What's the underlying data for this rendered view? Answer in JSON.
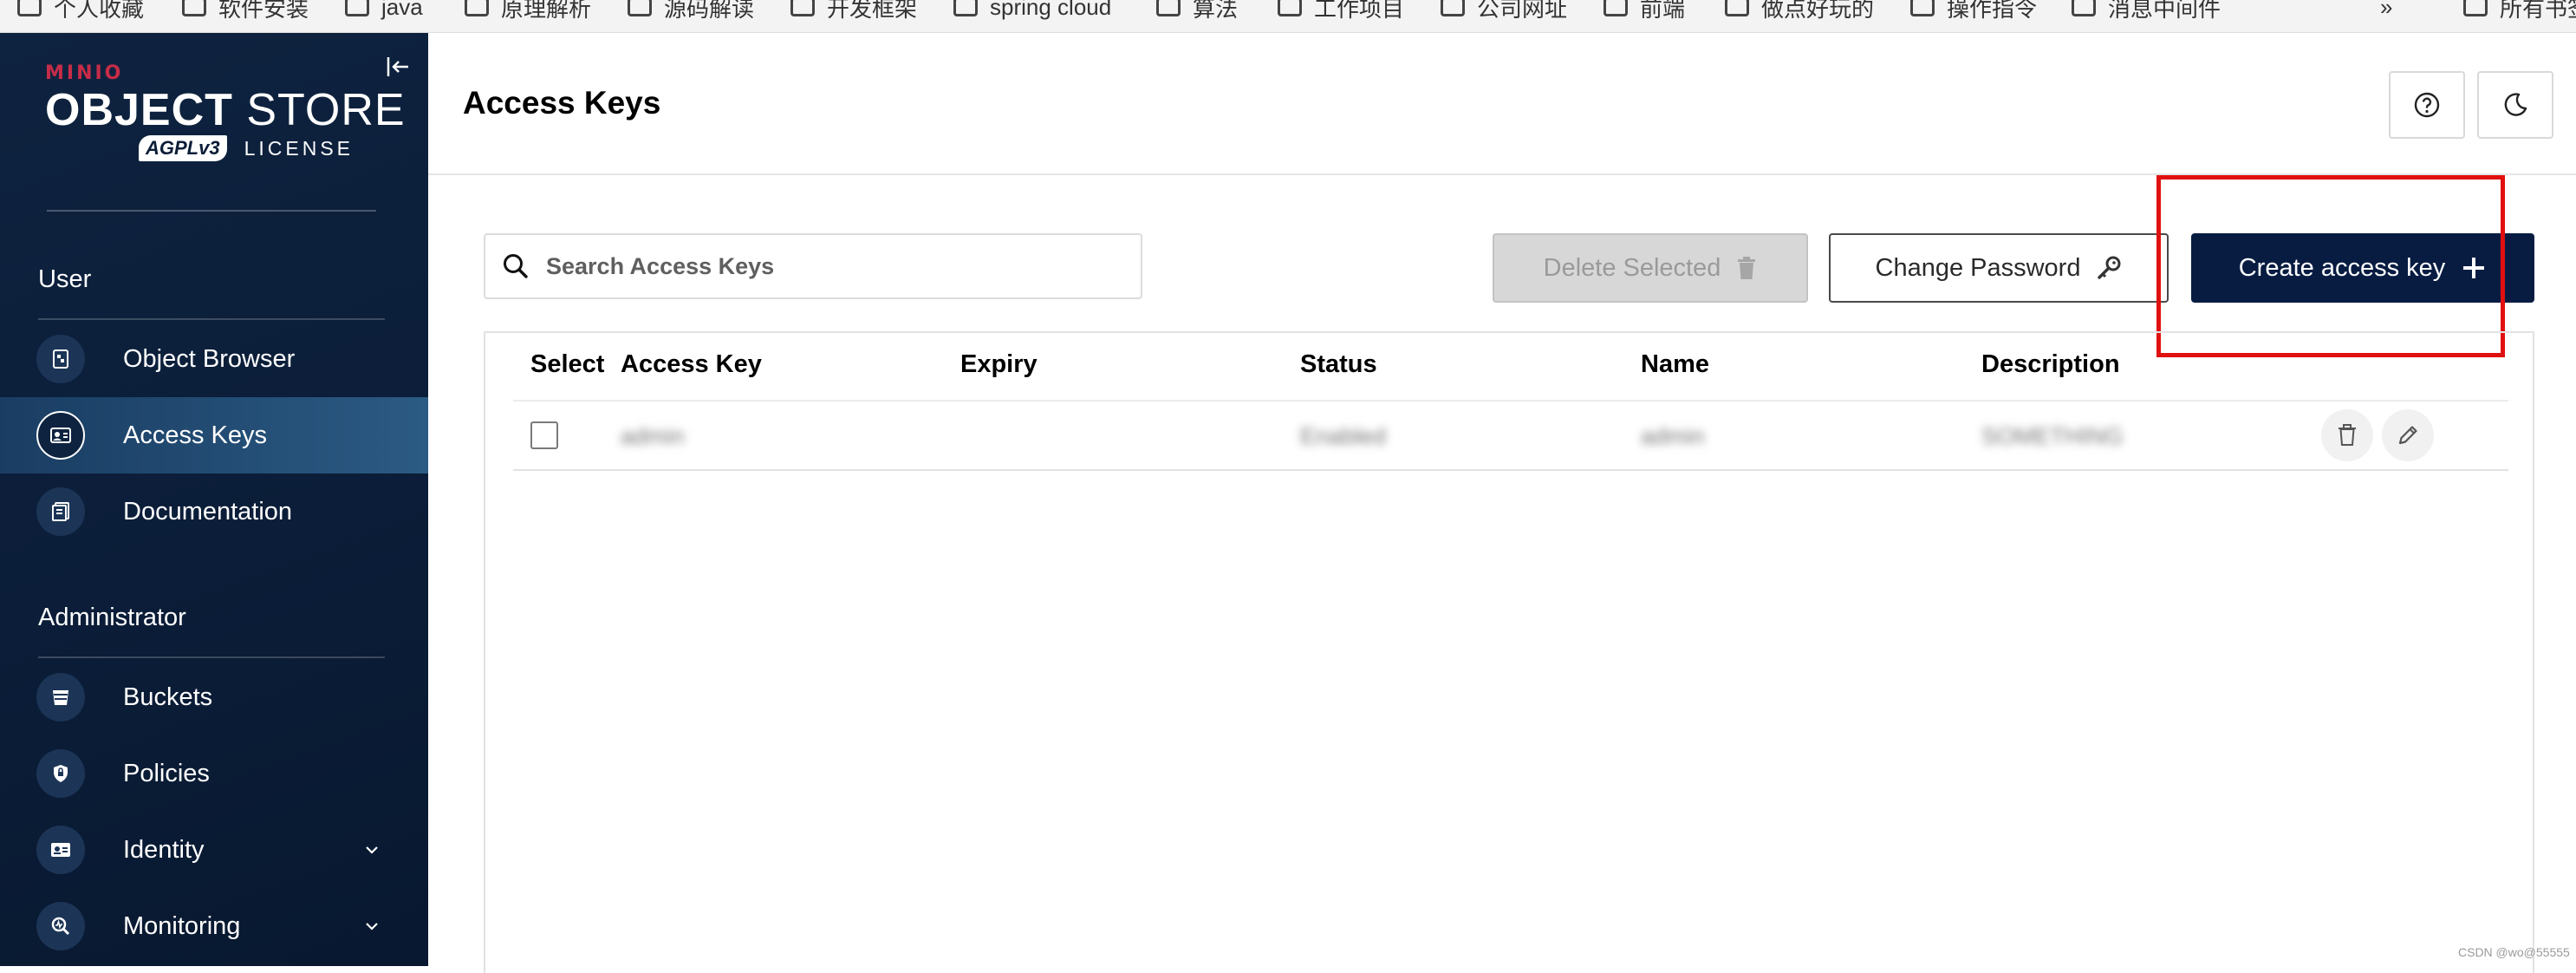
{
  "browser": {
    "bookmarks": [
      "个人收藏",
      "软件安装",
      "java",
      "原理解析",
      "源码解读",
      "开发框架",
      "spring cloud",
      "算法",
      "工作项目",
      "公司网址",
      "前端",
      "做点好玩的",
      "操作指令",
      "消息中间件",
      "所有书签"
    ],
    "overflow_glyph": "»"
  },
  "sidebar": {
    "logo": {
      "brand": "MINIO",
      "product_bold": "OBJECT",
      "product_light": " STORE",
      "license_badge": "AGPLv3",
      "license_text": "LICENSE"
    },
    "user_section": {
      "title": "User",
      "items": [
        {
          "label": "Object Browser",
          "icon": "object-browser-icon"
        },
        {
          "label": "Access Keys",
          "icon": "access-keys-icon",
          "active": true
        },
        {
          "label": "Documentation",
          "icon": "documentation-icon"
        }
      ]
    },
    "admin_section": {
      "title": "Administrator",
      "items": [
        {
          "label": "Buckets",
          "icon": "buckets-icon"
        },
        {
          "label": "Policies",
          "icon": "policies-icon"
        },
        {
          "label": "Identity",
          "icon": "identity-icon",
          "expandable": true
        },
        {
          "label": "Monitoring",
          "icon": "monitoring-icon",
          "expandable": true
        }
      ]
    }
  },
  "header": {
    "title": "Access Keys",
    "help_icon": "help-icon",
    "theme_icon": "dark-mode-icon"
  },
  "toolbar": {
    "search_placeholder": "Search Access Keys",
    "delete_label": "Delete Selected",
    "change_password_label": "Change Password",
    "create_label": "Create access key"
  },
  "table": {
    "columns": [
      "Select",
      "Access Key",
      "Expiry",
      "Status",
      "Name",
      "Description"
    ],
    "rows": [
      {
        "access_key": "admin",
        "expiry": "",
        "status": "Enabled",
        "name": "admin",
        "description": "SOMETHING"
      }
    ]
  },
  "watermark": "CSDN @wo@55555",
  "colors": {
    "sidebar_bg": "#0b1d38",
    "active_item": "#2b5a83",
    "primary_button": "#081c42",
    "brand_red": "#c72c48",
    "highlight_box": "#e01010"
  }
}
